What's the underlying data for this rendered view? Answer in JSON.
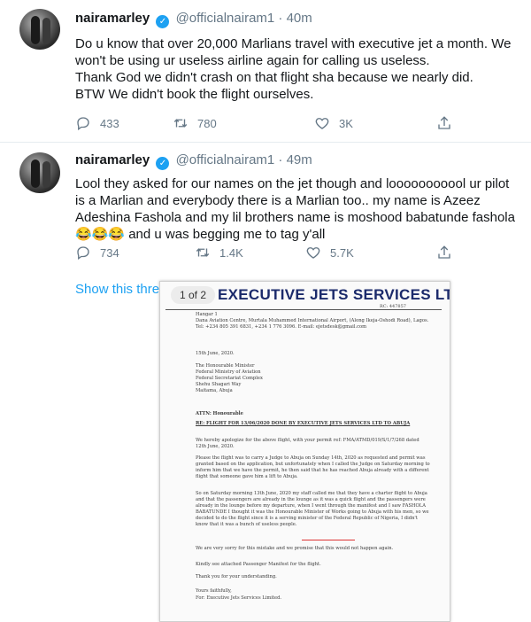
{
  "tweets": [
    {
      "name": "nairamarley",
      "handle": "@officialnairam1",
      "time_sep": "·",
      "time": "40m",
      "lines": [
        "Do u know that over 20,000 Marlians travel with executive jet a month. We",
        "won't be using ur useless airline again for calling us useless.",
        "Thank God we didn't crash on that flight sha because we nearly did.",
        "BTW We didn't book the flight ourselves."
      ],
      "replies": "433",
      "retweets": "780",
      "likes": "3K"
    },
    {
      "name": "nairamarley",
      "handle": "@officialnairam1",
      "time_sep": "·",
      "time": "49m",
      "lines": [
        "Lool they asked for our names on the jet though and looooooooool ur pilot",
        "is a Marlian and everybody there is a Marlian too.. my name is Azeez",
        "Adeshina Fashola and my lil brothers name is moshood babatunde fashola",
        "😂😂😂 and u was begging me to tag y'all"
      ],
      "replies": "734",
      "retweets": "1.4K",
      "likes": "5.7K"
    }
  ],
  "show_thread": "Show this thre",
  "document": {
    "page_indicator": "1 of 2",
    "title": "EXECUTIVE JETS SERVICES LTD.",
    "rc": "RC: 447857",
    "address": [
      "Hangar 1",
      "Dana Aviation Centre, Murtala Muhammed International Airport, (Along Ikeja-Oshodi Road), Lagos.",
      "Tel: +234 805 391 6831, +234 1 776 3096. E-mail: ejetsdesk@gmail.com"
    ],
    "date": "15th June, 2020.",
    "recipient": [
      "The Honourable Minister",
      "Federal Ministry of Aviation",
      "Federal Secretariat Complex",
      "Shehu Shagari Way",
      "Maitama, Abuja"
    ],
    "attn": "ATTN: Honourable",
    "subject": "RE: FLIGHT FOR 13/06/2020 DONE BY EXECUTIVE JETS SERVICES LTD TO ABUJA",
    "paragraphs": [
      "We hereby apologize for the above flight, with your permit ref: FMA/ATMD/019/S/1/7/268 dated 12th June, 2020.",
      "Please the flight was to carry a Judge to Abuja on Sunday 14th, 2020 as requested and permit was granted based on the application, but unfortunately when I called the Judge on Saturday morning to inform him that we have the permit, he then said that he has reached Abuja already with a different flight that someone gave him a lift to Abuja.",
      "So on Saturday morning 13th June, 2020 my staff called me that they have a charter flight to Abuja and that the passengers are already in the lounge as it was a quick flight and the passengers were already in the lounge before my departure, when I went through the manifest and I saw FASHOLA BABATUNDE I thought it was the Honourable Minister of Works going to Abuja with his men, so we decided to do the flight since it is a serving minister of the Federal Republic of Nigeria, I didn't know that it was a bunch of useless people.",
      "We are very sorry for this mistake and we promise that this would not happen again.",
      "Kindly see attached Passenger Manifest for the flight.",
      "Thank you for your understanding."
    ],
    "sign_off": "Yours faithfully,",
    "sign_company": "For: Executive Jets Services Limited."
  }
}
